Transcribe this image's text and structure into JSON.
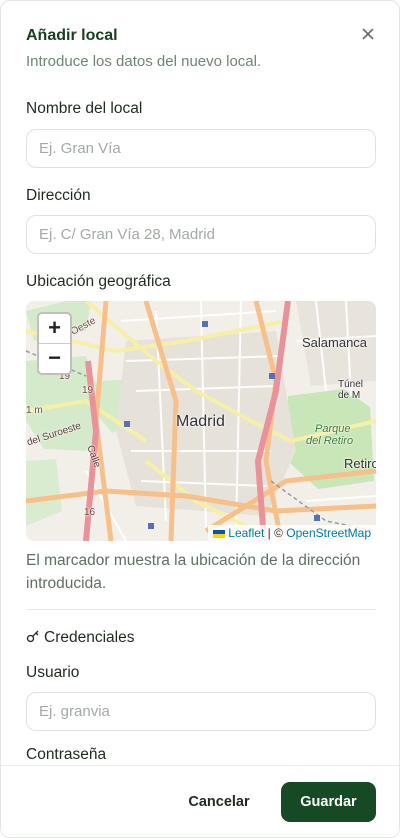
{
  "dialog": {
    "title": "Añadir local",
    "subtitle": "Introduce los datos del nuevo local."
  },
  "form": {
    "name": {
      "label": "Nombre del local",
      "placeholder": "Ej. Gran Vía",
      "value": ""
    },
    "address": {
      "label": "Dirección",
      "placeholder": "Ej. C/ Gran Vía 28, Madrid",
      "value": ""
    },
    "location": {
      "label": "Ubicación geográfica"
    },
    "helper": "El marcador muestra la ubicación de la dirección introducida.",
    "credentials": {
      "title": "Credenciales",
      "icon": "key-icon"
    },
    "user": {
      "label": "Usuario",
      "placeholder": "Ej. granvia",
      "value": ""
    },
    "password": {
      "label": "Contraseña"
    }
  },
  "map": {
    "zoom_in": "+",
    "zoom_out": "−",
    "labels": {
      "madrid": "Madrid",
      "salamanca": "Salamanca",
      "retiro": "Retiro",
      "parque_retiro_1": "Parque",
      "parque_retiro_2": "del Retiro",
      "oeste": "Oeste",
      "del_suroeste": "del Suroeste",
      "calle": "Calle",
      "tunel": "Túnel de M",
      "road_19": "19",
      "road_16": "16",
      "road_1m": "1 m"
    },
    "attribution": {
      "leaflet": "Leaflet",
      "separator": "| ©",
      "osm": "OpenStreetMap"
    }
  },
  "footer": {
    "cancel": "Cancelar",
    "save": "Guardar"
  },
  "colors": {
    "primary": "#154a25",
    "title": "#163f22",
    "muted": "#6e8573"
  }
}
